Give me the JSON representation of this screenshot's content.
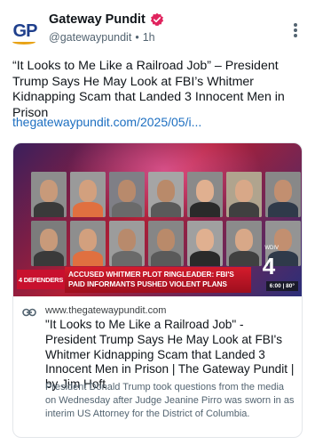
{
  "account": {
    "display_name": "Gateway Pundit",
    "handle": "@gatewaypundit",
    "separator": "•",
    "time_ago": "1h",
    "avatar_text": "GP",
    "verified_color": "#e0245e"
  },
  "post": {
    "text": "“It Looks to Me Like a Railroad Job” – President Trump Says He May Look at FBI’s Whitmer Kidnapping Scam that Landed 3 Innocent Men in Prison",
    "link": "thegatewaypundit.com/2025/05/i..."
  },
  "card": {
    "chyron_badge": "4 DEFENDERS",
    "chyron_text": "ACCUSED WHITMER PLOT RINGLEADER: FBI'S PAID INFORMANTS PUSHED VIOLENT PLANS",
    "station_number": "4",
    "station_call": "WDIV",
    "clock": "6:00 | 80°",
    "domain": "www.thegatewaypundit.com",
    "title": "\"It Looks to Me Like a Railroad Job\" - President Trump Says He May Look at FBI's Whitmer Kidnapping Scam that Landed 3 Innocent Men in Prison | The Gateway Pundit | by Jim Hoft",
    "description": "President Donald Trump took questions from the media on Wednesday after Judge Jeanine Pirro was sworn in as interim US Attorney for the District of Columbia."
  },
  "colors": {
    "link": "#1d6fc1",
    "muted": "#536471",
    "brand_red": "#c8102e"
  }
}
